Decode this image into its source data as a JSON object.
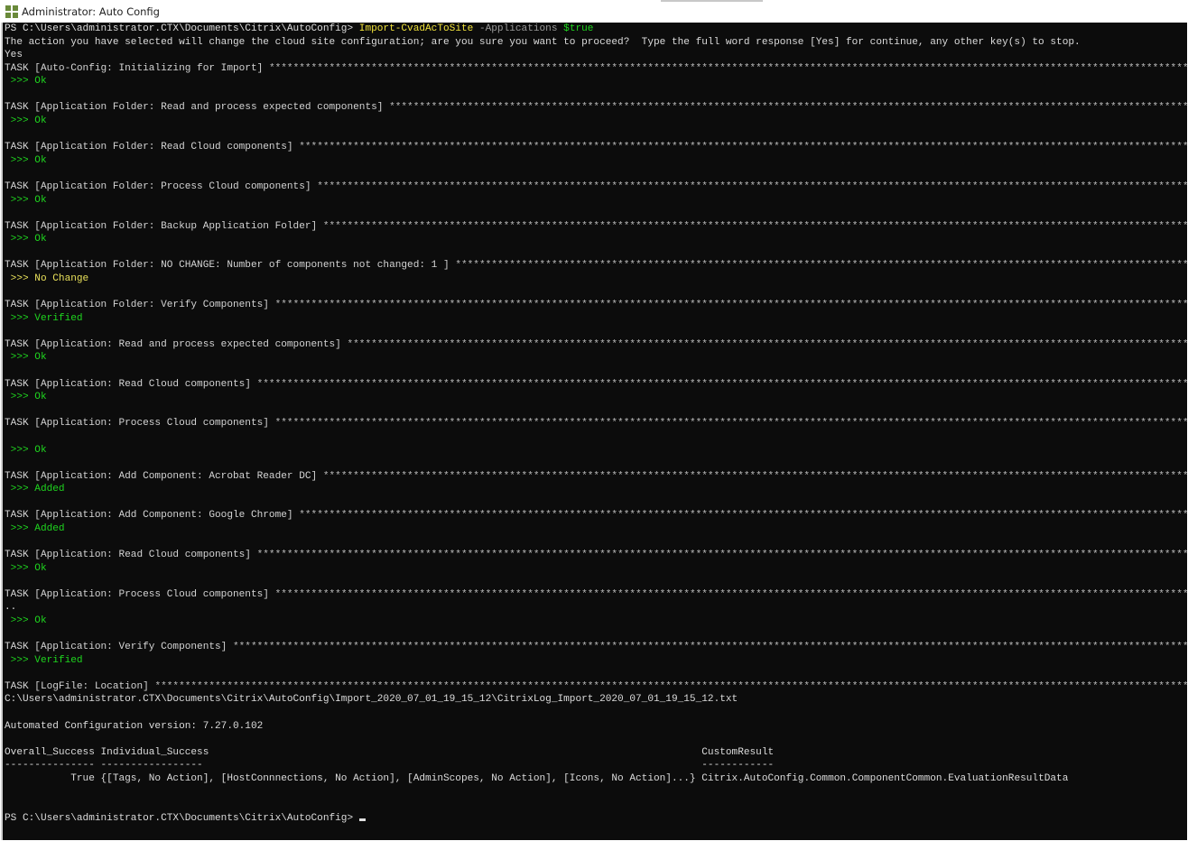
{
  "window": {
    "title": "Administrator: Auto Config",
    "icon": "powershell-app-icon"
  },
  "colors": {
    "background": "#0c0c0c",
    "ok": "#1fd61f",
    "command": "#f0e23a",
    "nochange": "#e8e05a"
  },
  "task_rule_char": "*",
  "lines": [
    {
      "segs": [
        {
          "t": "PS C:\\Users\\administrator.CTX\\Documents\\Citrix\\AutoConfig> ",
          "c": "w"
        },
        {
          "t": "Import-CvadAcToSite",
          "c": "y"
        },
        {
          "t": " -Applications ",
          "c": "gr"
        },
        {
          "t": "$true",
          "c": "g"
        }
      ]
    },
    {
      "segs": [
        {
          "t": "The action you have selected will change the cloud site configuration; are you sure you want to proceed?  Type the full word response [Yes] for continue, any other key(s) to stop.",
          "c": "w"
        }
      ]
    },
    {
      "segs": [
        {
          "t": "Yes",
          "c": "w"
        }
      ]
    },
    {
      "task": "TASK [Auto-Config: Initializing for Import] "
    },
    {
      "segs": [
        {
          "t": " >>> Ok",
          "c": "g"
        }
      ]
    },
    {},
    {
      "task": "TASK [Application Folder: Read and process expected components] "
    },
    {
      "segs": [
        {
          "t": " >>> Ok",
          "c": "g"
        }
      ]
    },
    {},
    {
      "task": "TASK [Application Folder: Read Cloud components] "
    },
    {
      "segs": [
        {
          "t": " >>> Ok",
          "c": "g"
        }
      ]
    },
    {},
    {
      "task": "TASK [Application Folder: Process Cloud components] "
    },
    {
      "segs": [
        {
          "t": " >>> Ok",
          "c": "g"
        }
      ]
    },
    {},
    {
      "task": "TASK [Application Folder: Backup Application Folder] "
    },
    {
      "segs": [
        {
          "t": " >>> Ok",
          "c": "g"
        }
      ]
    },
    {},
    {
      "task": "TASK [Application Folder: NO CHANGE: Number of components not changed: 1 ] "
    },
    {
      "segs": [
        {
          "t": " >>> No Change",
          "c": "vy"
        }
      ]
    },
    {},
    {
      "task": "TASK [Application Folder: Verify Components] "
    },
    {
      "segs": [
        {
          "t": " >>> Verified",
          "c": "g"
        }
      ]
    },
    {},
    {
      "task": "TASK [Application: Read and process expected components] "
    },
    {
      "segs": [
        {
          "t": " >>> Ok",
          "c": "g"
        }
      ]
    },
    {},
    {
      "task": "TASK [Application: Read Cloud components] "
    },
    {
      "segs": [
        {
          "t": " >>> Ok",
          "c": "g"
        }
      ]
    },
    {},
    {
      "task": "TASK [Application: Process Cloud components] "
    },
    {},
    {
      "segs": [
        {
          "t": " >>> Ok",
          "c": "g"
        }
      ]
    },
    {},
    {
      "task": "TASK [Application: Add Component: Acrobat Reader DC] "
    },
    {
      "segs": [
        {
          "t": " >>> Added",
          "c": "g"
        }
      ]
    },
    {},
    {
      "task": "TASK [Application: Add Component: Google Chrome] "
    },
    {
      "segs": [
        {
          "t": " >>> Added",
          "c": "g"
        }
      ]
    },
    {},
    {
      "task": "TASK [Application: Read Cloud components] "
    },
    {
      "segs": [
        {
          "t": " >>> Ok",
          "c": "g"
        }
      ]
    },
    {},
    {
      "task": "TASK [Application: Process Cloud components] "
    },
    {
      "segs": [
        {
          "t": "..",
          "c": "w"
        }
      ]
    },
    {
      "segs": [
        {
          "t": " >>> Ok",
          "c": "g"
        }
      ]
    },
    {},
    {
      "task": "TASK [Application: Verify Components] "
    },
    {
      "segs": [
        {
          "t": " >>> Verified",
          "c": "g"
        }
      ]
    },
    {},
    {
      "task": "TASK [LogFile: Location] "
    },
    {
      "segs": [
        {
          "t": "C:\\Users\\administrator.CTX\\Documents\\Citrix\\AutoConfig\\Import_2020_07_01_19_15_12\\CitrixLog_Import_2020_07_01_19_15_12.txt",
          "c": "w"
        }
      ]
    },
    {},
    {
      "segs": [
        {
          "t": "Automated Configuration version: 7.27.0.102",
          "c": "w"
        }
      ]
    },
    {},
    {
      "row": [
        "Overall_Success Individual_Success",
        "CustomResult"
      ]
    },
    {
      "row": [
        "--------------- -----------------",
        "------------"
      ]
    },
    {
      "row": [
        "           True {[Tags, No Action], [HostConnnections, No Action], [AdminScopes, No Action], [Icons, No Action]...}",
        "Citrix.AutoConfig.Common.ComponentCommon.EvaluationResultData"
      ]
    },
    {},
    {},
    {
      "segs": [
        {
          "t": "PS C:\\Users\\administrator.CTX\\Documents\\Citrix\\AutoConfig> ",
          "c": "w"
        }
      ],
      "cursor": true
    }
  ]
}
